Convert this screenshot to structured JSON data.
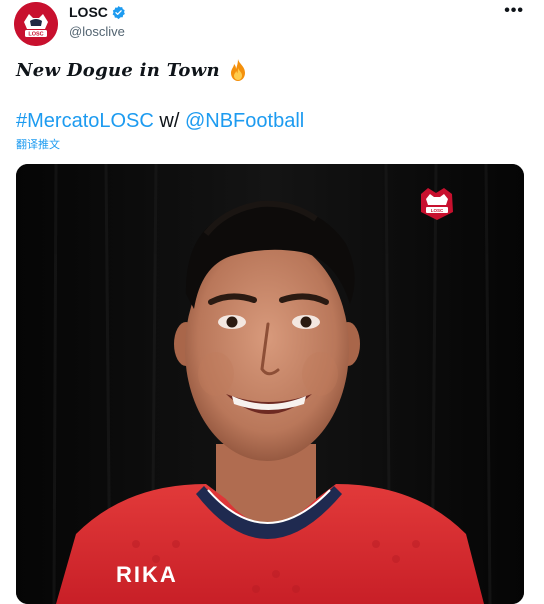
{
  "account": {
    "display_name": "LOSC",
    "handle": "@losclive",
    "avatar_label": "LOSC"
  },
  "header": {
    "more_label": "•••"
  },
  "tweet": {
    "line1_text": "New Dogue in Town",
    "hashtag": "#MercatoLOSC",
    "connector": " w/ ",
    "mention": "@NBFootball",
    "translate_label": "翻译推文"
  },
  "media": {
    "shirt_text": "RIKA",
    "watermark_label": "LOSC"
  },
  "colors": {
    "brand_red": "#c8102e",
    "link_blue": "#1d9bf0"
  }
}
